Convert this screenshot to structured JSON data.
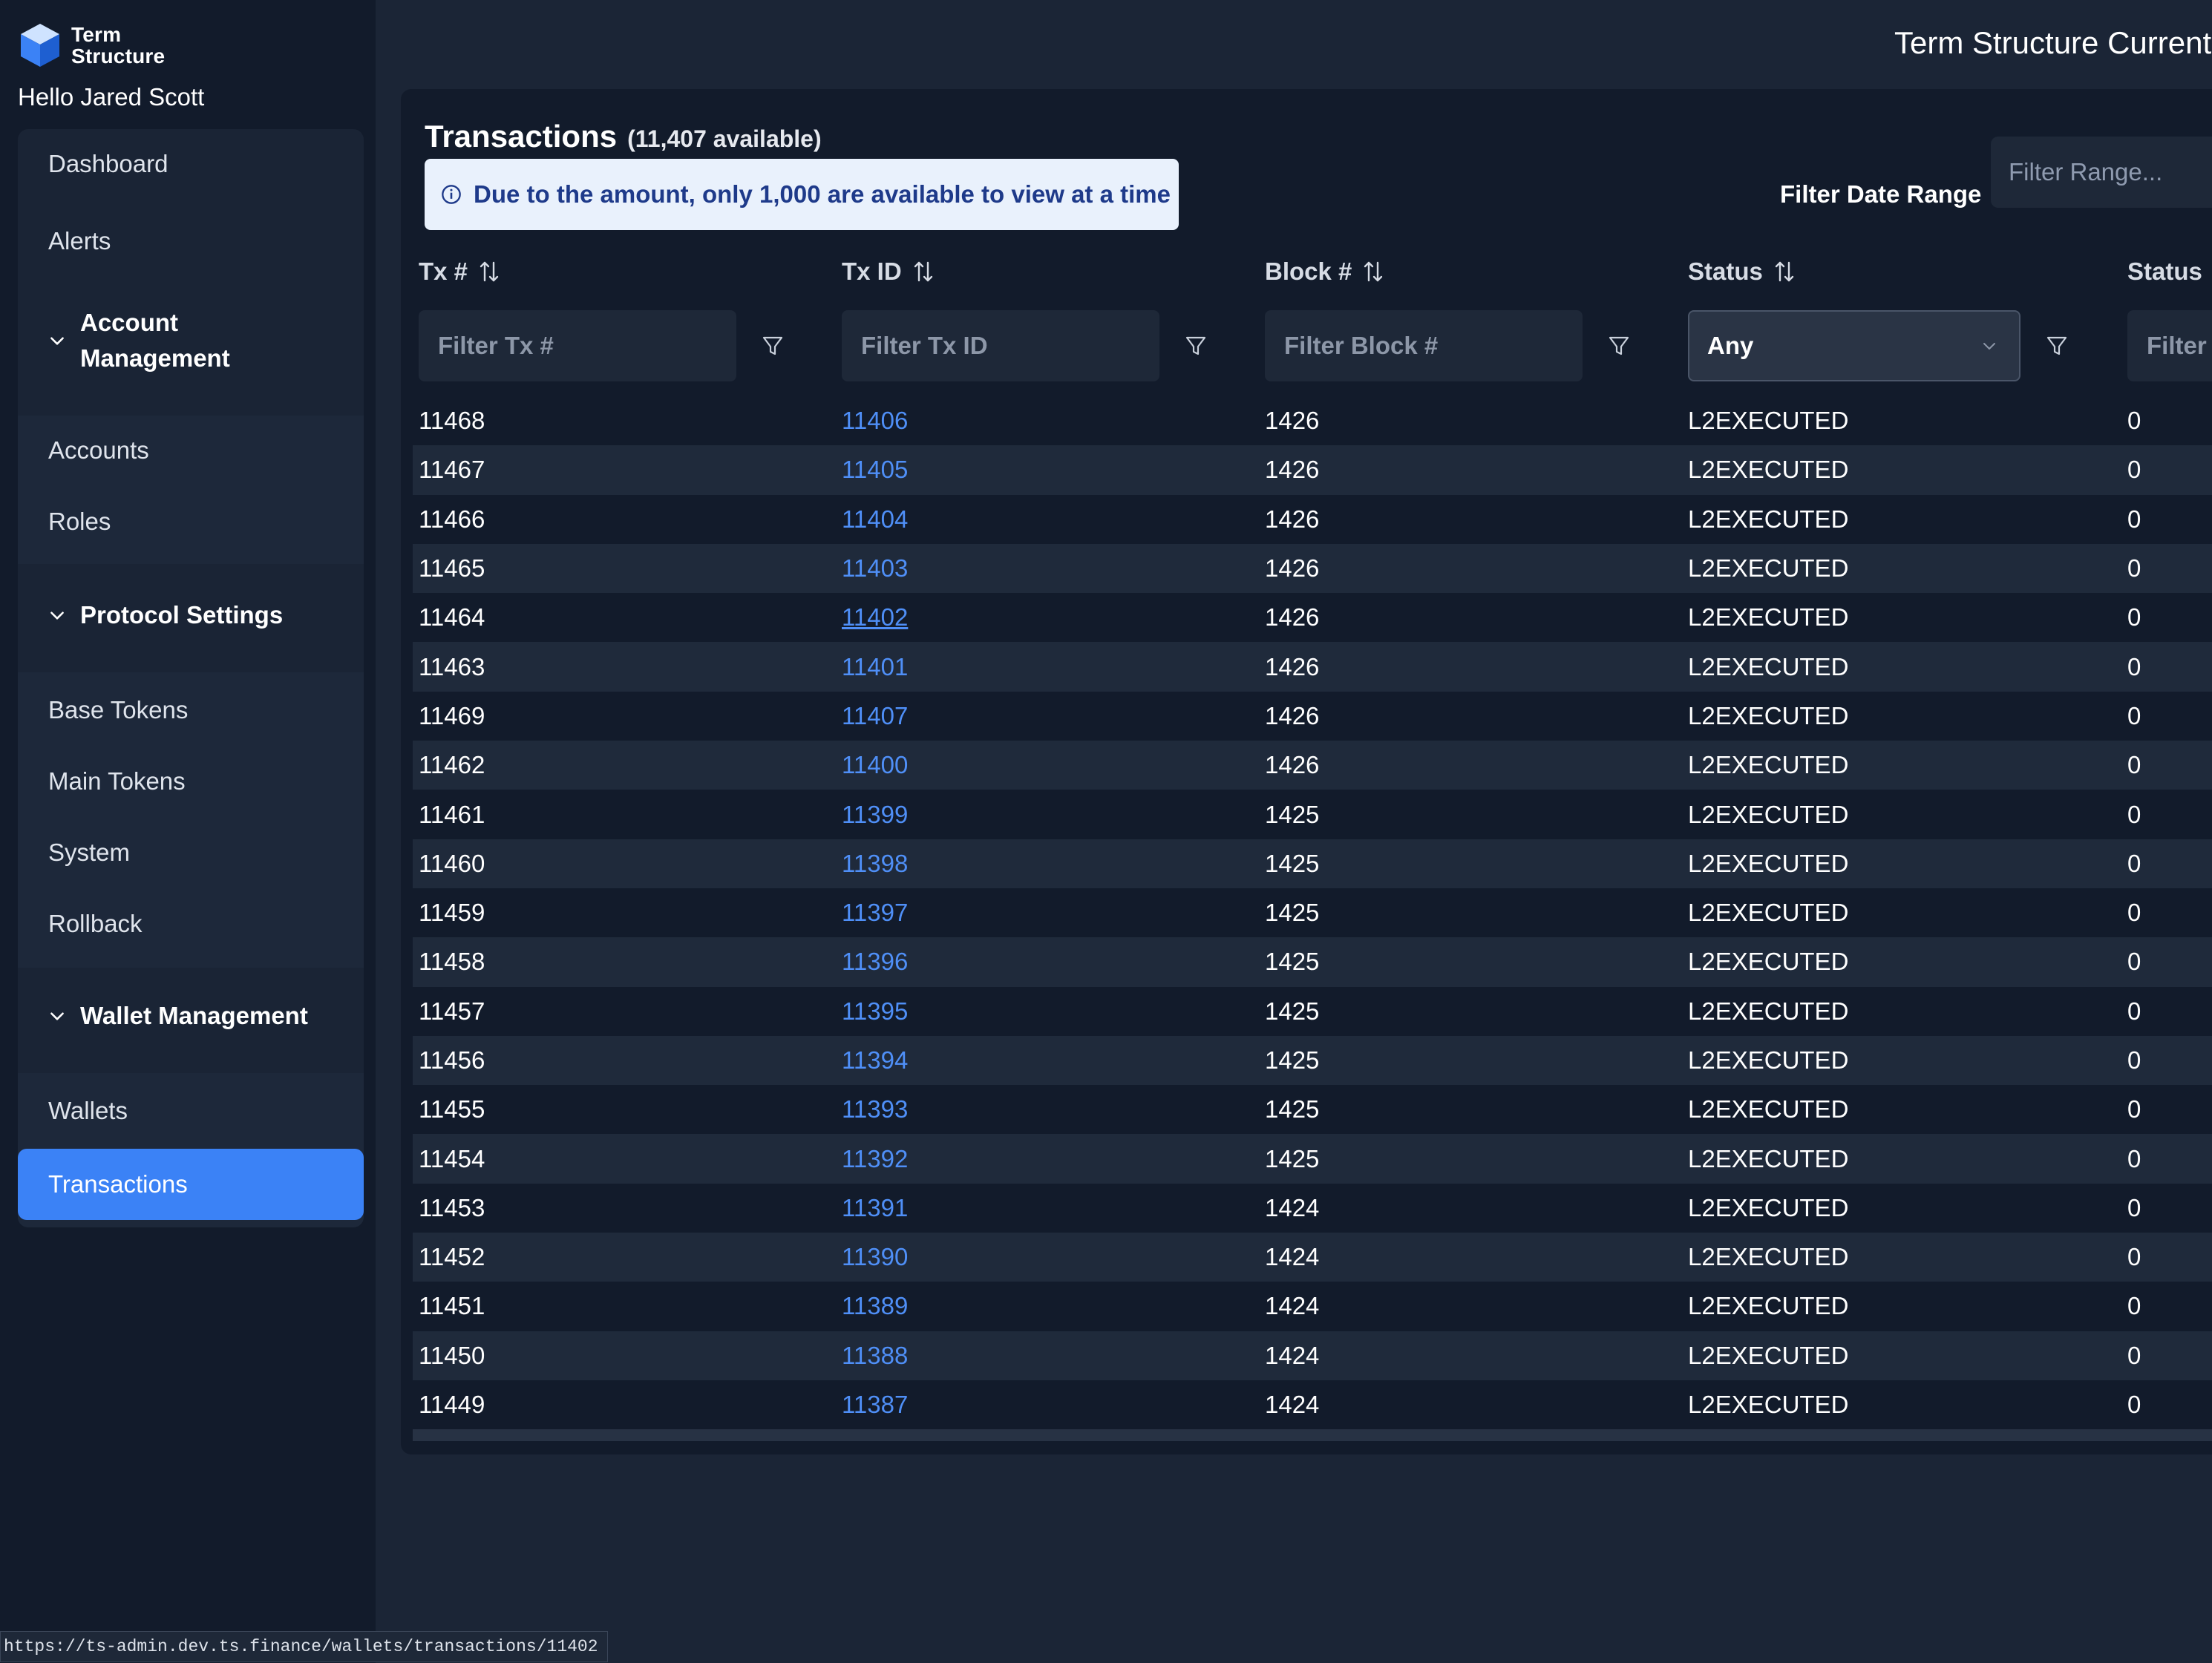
{
  "brand": {
    "line1": "Term",
    "line2": "Structure"
  },
  "greeting": "Hello Jared Scott",
  "header": {
    "title": "Term Structure Current"
  },
  "sidebar": {
    "items": {
      "dashboard": "Dashboard",
      "alerts": "Alerts",
      "account_management": "Account Management",
      "accounts": "Accounts",
      "roles": "Roles",
      "protocol_settings": "Protocol Settings",
      "base_tokens": "Base Tokens",
      "main_tokens": "Main Tokens",
      "system": "System",
      "rollback": "Rollback",
      "wallet_management": "Wallet Management",
      "wallets": "Wallets",
      "transactions": "Transactions"
    }
  },
  "page": {
    "title": "Transactions",
    "available": "(11,407 available)",
    "notice": "Due to the amount, only 1,000 are available to view at a time",
    "date_label": "Filter Date Range",
    "date_placeholder": "Filter Range..."
  },
  "table": {
    "headers": {
      "tx": "Tx #",
      "txid": "Tx ID",
      "block": "Block #",
      "status": "Status",
      "status2": "Status"
    },
    "filters": {
      "tx": "Filter Tx #",
      "txid": "Filter Tx ID",
      "block": "Filter Block #",
      "status_value": "Any",
      "status2": "Filter"
    },
    "rows": [
      {
        "tx": "11468",
        "txid": "11406",
        "block": "1426",
        "status": "L2EXECUTED",
        "status2": "0"
      },
      {
        "tx": "11467",
        "txid": "11405",
        "block": "1426",
        "status": "L2EXECUTED",
        "status2": "0"
      },
      {
        "tx": "11466",
        "txid": "11404",
        "block": "1426",
        "status": "L2EXECUTED",
        "status2": "0"
      },
      {
        "tx": "11465",
        "txid": "11403",
        "block": "1426",
        "status": "L2EXECUTED",
        "status2": "0"
      },
      {
        "tx": "11464",
        "txid": "11402",
        "block": "1426",
        "status": "L2EXECUTED",
        "status2": "0"
      },
      {
        "tx": "11463",
        "txid": "11401",
        "block": "1426",
        "status": "L2EXECUTED",
        "status2": "0"
      },
      {
        "tx": "11469",
        "txid": "11407",
        "block": "1426",
        "status": "L2EXECUTED",
        "status2": "0"
      },
      {
        "tx": "11462",
        "txid": "11400",
        "block": "1426",
        "status": "L2EXECUTED",
        "status2": "0"
      },
      {
        "tx": "11461",
        "txid": "11399",
        "block": "1425",
        "status": "L2EXECUTED",
        "status2": "0"
      },
      {
        "tx": "11460",
        "txid": "11398",
        "block": "1425",
        "status": "L2EXECUTED",
        "status2": "0"
      },
      {
        "tx": "11459",
        "txid": "11397",
        "block": "1425",
        "status": "L2EXECUTED",
        "status2": "0"
      },
      {
        "tx": "11458",
        "txid": "11396",
        "block": "1425",
        "status": "L2EXECUTED",
        "status2": "0"
      },
      {
        "tx": "11457",
        "txid": "11395",
        "block": "1425",
        "status": "L2EXECUTED",
        "status2": "0"
      },
      {
        "tx": "11456",
        "txid": "11394",
        "block": "1425",
        "status": "L2EXECUTED",
        "status2": "0"
      },
      {
        "tx": "11455",
        "txid": "11393",
        "block": "1425",
        "status": "L2EXECUTED",
        "status2": "0"
      },
      {
        "tx": "11454",
        "txid": "11392",
        "block": "1425",
        "status": "L2EXECUTED",
        "status2": "0"
      },
      {
        "tx": "11453",
        "txid": "11391",
        "block": "1424",
        "status": "L2EXECUTED",
        "status2": "0"
      },
      {
        "tx": "11452",
        "txid": "11390",
        "block": "1424",
        "status": "L2EXECUTED",
        "status2": "0"
      },
      {
        "tx": "11451",
        "txid": "11389",
        "block": "1424",
        "status": "L2EXECUTED",
        "status2": "0"
      },
      {
        "tx": "11450",
        "txid": "11388",
        "block": "1424",
        "status": "L2EXECUTED",
        "status2": "0"
      },
      {
        "tx": "11449",
        "txid": "11387",
        "block": "1424",
        "status": "L2EXECUTED",
        "status2": "0"
      }
    ]
  },
  "status_bar": {
    "url": "https://ts-admin.dev.ts.finance/wallets/transactions/11402"
  },
  "colors": {
    "accent": "#3b82f6",
    "link": "#4f8ff7",
    "sidebar_bg": "#121b2b",
    "page_bg": "#1b2536",
    "notice_bg": "#e9f1fc"
  },
  "icons": {
    "logo": "cube-logo-icon",
    "chevron": "chevron-down-icon",
    "sort": "sort-icon",
    "filter": "filter-icon",
    "info": "info-icon"
  }
}
